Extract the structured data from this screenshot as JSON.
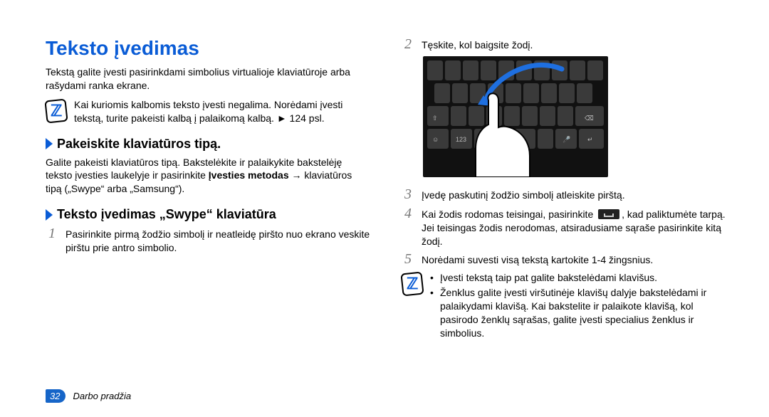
{
  "left": {
    "title": "Teksto įvedimas",
    "intro": "Tekstą galite įvesti pasirinkdami simbolius virtualioje klaviatūroje arba rašydami ranka ekrane.",
    "note": "Kai kuriomis kalbomis teksto įvesti negalima. Norėdami įvesti tekstą, turite pakeisti kalbą į palaikomą kalbą. ► 124 psl.",
    "subhead1": "Pakeiskite klaviatūros tipą.",
    "subhead1_body_a": "Galite pakeisti klaviatūros tipą. Bakstelėkite ir palaikykite bakstelėję teksto įvesties laukelyje ir pasirinkite ",
    "subhead1_body_bold": "Įvesties metodas",
    "subhead1_body_c": " → klaviatūros tipą („Swype“ arba „Samsung“).",
    "subhead2": "Teksto įvedimas „Swype“ klaviatūra",
    "step1": "Pasirinkite pirmą žodžio simbolį ir neatleidę piršto nuo ekrano veskite pirštu prie antro simbolio."
  },
  "right": {
    "step2": "Tęskite, kol baigsite žodį.",
    "step3": "Įvedę paskutinį žodžio simbolį atleiskite pirštą.",
    "step4_a": "Kai žodis rodomas teisingai, pasirinkite ",
    "step4_b": ", kad paliktumėte tarpą. Jei teisingas žodis nerodomas, atsiradusiame sąraše pasirinkite kitą žodį.",
    "step5": "Norėdami suvesti visą tekstą kartokite 1-4 žingsnius.",
    "note_b1": "Įvesti tekstą taip pat galite bakstelėdami klavišus.",
    "note_b2": "Ženklus galite įvesti viršutinėje klavišų dalyje bakstelėdami ir palaikydami klavišą. Kai bakstelite ir palaikote klavišą, kol pasirodo ženklų sąrašas, galite įvesti specialius ženklus ir simbolius."
  },
  "footer": {
    "page": "32",
    "section": "Darbo pradžia"
  },
  "nums": {
    "n1": "1",
    "n2": "2",
    "n3": "3",
    "n4": "4",
    "n5": "5"
  }
}
